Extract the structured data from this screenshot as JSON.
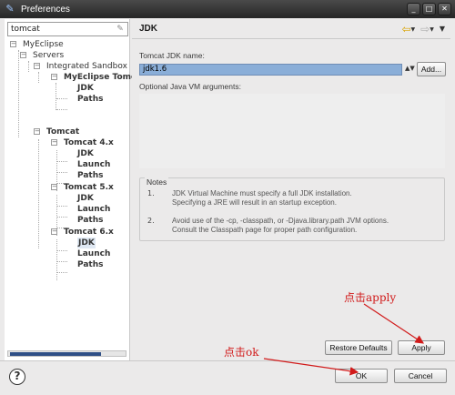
{
  "window": {
    "title": "Preferences"
  },
  "filter": {
    "value": "tomcat"
  },
  "tree": [
    {
      "label": "MyEclipse",
      "bold": false,
      "selected": false
    },
    {
      "label": "Servers",
      "bold": false,
      "selected": false
    },
    {
      "label": "Integrated Sandbox",
      "bold": false,
      "selected": false
    },
    {
      "label": "MyEclipse Tomc",
      "bold": true,
      "selected": false
    },
    {
      "label": "JDK",
      "bold": true,
      "selected": false
    },
    {
      "label": "Paths",
      "bold": true,
      "selected": false
    },
    {
      "label": "Tomcat",
      "bold": true,
      "selected": false
    },
    {
      "label": "Tomcat 4.x",
      "bold": true,
      "selected": false
    },
    {
      "label": "JDK",
      "bold": true,
      "selected": false
    },
    {
      "label": "Launch",
      "bold": true,
      "selected": false
    },
    {
      "label": "Paths",
      "bold": true,
      "selected": false
    },
    {
      "label": "Tomcat 5.x",
      "bold": true,
      "selected": false
    },
    {
      "label": "JDK",
      "bold": true,
      "selected": false
    },
    {
      "label": "Launch",
      "bold": true,
      "selected": false
    },
    {
      "label": "Paths",
      "bold": true,
      "selected": false
    },
    {
      "label": "Tomcat 6.x",
      "bold": true,
      "selected": false
    },
    {
      "label": "JDK",
      "bold": true,
      "selected": true
    },
    {
      "label": "Launch",
      "bold": true,
      "selected": false
    },
    {
      "label": "Paths",
      "bold": true,
      "selected": false
    }
  ],
  "page": {
    "title": "JDK",
    "jdk_name_label": "Tomcat JDK name:",
    "jdk_name_value": "jdk1.6",
    "add_button": "Add...",
    "jvm_args_label": "Optional Java VM arguments:",
    "notes_title": "Notes",
    "notes": [
      {
        "num": "1.",
        "line1": "JDK Virtual Machine must specify a full JDK installation.",
        "line2": "Specifying a JRE will result in an startup exception."
      },
      {
        "num": "2.",
        "line1": "Avoid use of the -cp, -classpath, or -Djava.library.path JVM options.",
        "line2": "Consult the Classpath page for proper path configuration."
      }
    ],
    "restore_defaults_button": "Restore Defaults",
    "apply_button": "Apply"
  },
  "footer": {
    "ok_button": "OK",
    "cancel_button": "Cancel"
  },
  "annotations": {
    "apply_note": "点击apply",
    "ok_note": "点击ok"
  },
  "colors": {
    "annotation": "#d11a1a",
    "selection": "#8aaed8",
    "titlebar": "#2e2e2e"
  }
}
